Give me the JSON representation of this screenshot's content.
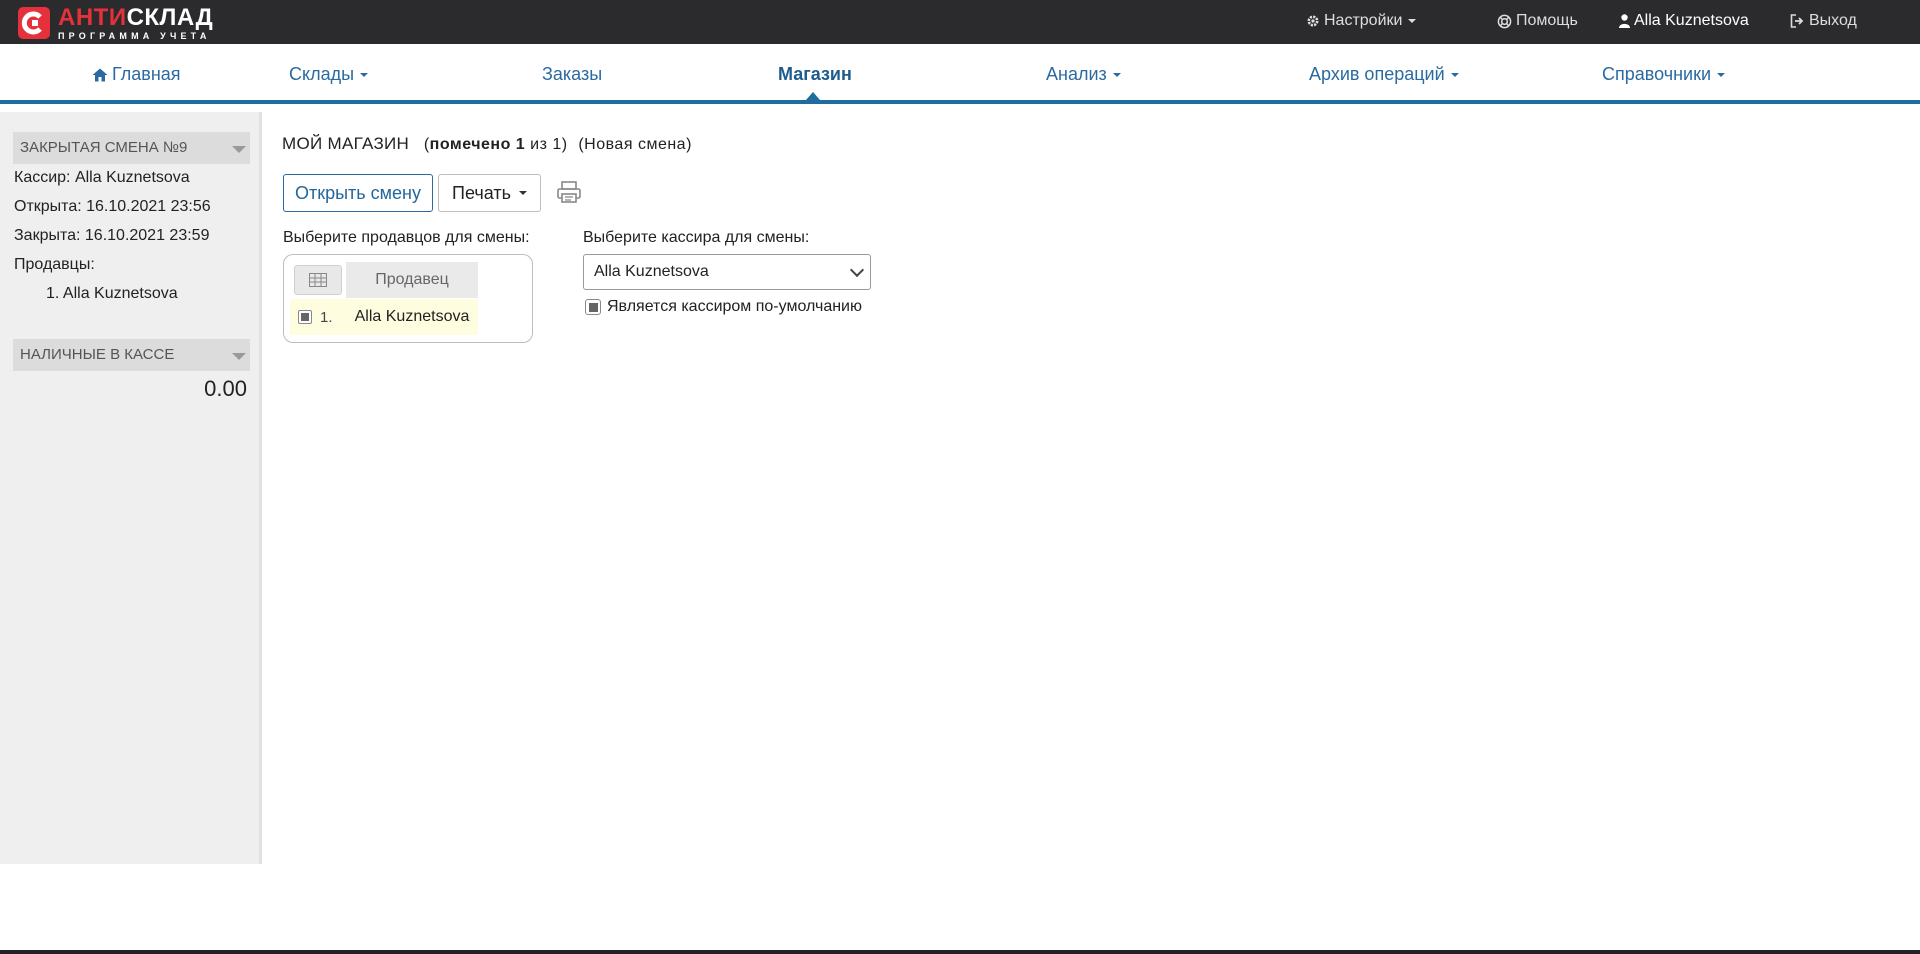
{
  "brand": {
    "title_red": "АНТИ",
    "title_white": "СКЛАД",
    "subtitle": "ПРОГРАММА УЧЕТА",
    "accent_red": "#e4313b"
  },
  "topbar": {
    "settings": "Настройки",
    "help": "Помощь",
    "user": "Alla Kuznetsova",
    "logout": "Выход"
  },
  "nav": {
    "home": "Главная",
    "warehouses": "Склады",
    "orders": "Заказы",
    "shop": "Магазин",
    "analysis": "Анализ",
    "archive": "Архив операций",
    "references": "Справочники",
    "active": "Магазин",
    "accent_blue": "#1f6d9e"
  },
  "sidebar": {
    "shift_header": "ЗАКРЫТАЯ СМЕНА №9",
    "cashier": "Кассир: Alla Kuznetsova",
    "opened": "Открыта: 16.10.2021 23:56",
    "closed": "Закрыта: 16.10.2021 23:59",
    "sellers_label": "Продавцы:",
    "sellers": [
      "1. Alla Kuznetsova"
    ],
    "cash_header": "НАЛИЧНЫЕ В КАССЕ",
    "cash_value": "0.00"
  },
  "main": {
    "title": "МОЙ МАГАЗИН",
    "marked_prefix": "(",
    "marked_bold": "помечено 1",
    "marked_rest": " из 1)",
    "shift_status": "(Новая смена)",
    "open_shift_button": "Открыть смену",
    "print_button": "Печать",
    "sellers_label": "Выберите продавцов для смены:",
    "sellers_table": {
      "column": "Продавец",
      "rows": [
        {
          "num": "1.",
          "name": "Alla Kuznetsova",
          "checked": true
        }
      ]
    },
    "cashier_label": "Выберите кассира для смены:",
    "cashier_select": "Alla Kuznetsova",
    "default_cashier_checkbox": "Является кассиром по-умолчанию"
  }
}
